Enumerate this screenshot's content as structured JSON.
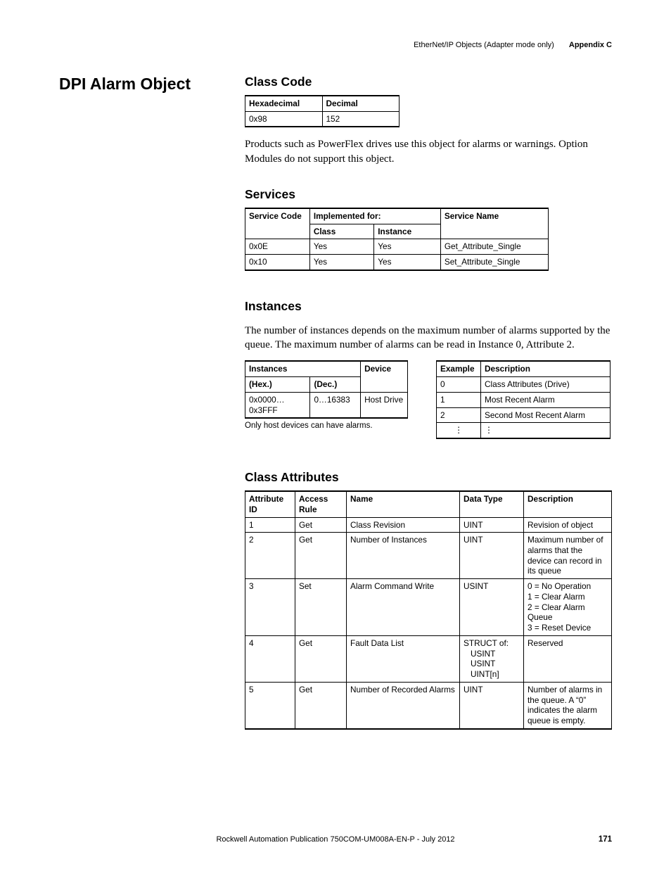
{
  "running_head": {
    "title": "EtherNet/IP Objects (Adapter mode only)",
    "appendix": "Appendix C"
  },
  "side_heading": "DPI Alarm Object",
  "class_code": {
    "heading": "Class Code",
    "headers": {
      "hex": "Hexadecimal",
      "dec": "Decimal"
    },
    "row": {
      "hex": "0x98",
      "dec": "152"
    }
  },
  "intro_paragraph": "Products such as PowerFlex drives use this object for alarms or warnings. Option Modules do not support this object.",
  "services": {
    "heading": "Services",
    "headers": {
      "code": "Service Code",
      "impl": "Implemented for:",
      "class": "Class",
      "instance": "Instance",
      "name": "Service Name"
    },
    "rows": [
      {
        "code": "0x0E",
        "class": "Yes",
        "instance": "Yes",
        "name": "Get_Attribute_Single"
      },
      {
        "code": "0x10",
        "class": "Yes",
        "instance": "Yes",
        "name": "Set_Attribute_Single"
      }
    ]
  },
  "instances": {
    "heading": "Instances",
    "paragraph": "The number of instances depends on the maximum number of alarms supported by the queue. The maximum number of alarms can be read in Instance 0, Attribute 2.",
    "table": {
      "headers": {
        "instances": "Instances",
        "device": "Device",
        "hex": "(Hex.)",
        "dec": "(Dec.)"
      },
      "row": {
        "hex": "0x0000…0x3FFF",
        "dec": "0…16383",
        "device": "Host Drive"
      }
    },
    "footnote": "Only host devices can have alarms.",
    "examples": {
      "headers": {
        "example": "Example",
        "desc": "Description"
      },
      "rows": [
        {
          "ex": "0",
          "desc": "Class Attributes (Drive)"
        },
        {
          "ex": "1",
          "desc": "Most Recent Alarm"
        },
        {
          "ex": "2",
          "desc": "Second Most Recent Alarm"
        },
        {
          "ex": "⋮",
          "desc": "⋮"
        }
      ]
    }
  },
  "class_attributes": {
    "heading": "Class Attributes",
    "headers": {
      "id": "Attribute ID",
      "rule": "Access Rule",
      "name": "Name",
      "type": "Data Type",
      "desc": "Description"
    },
    "rows": [
      {
        "id": "1",
        "rule": "Get",
        "name": "Class Revision",
        "type": "UINT",
        "desc": "Revision of object"
      },
      {
        "id": "2",
        "rule": "Get",
        "name": "Number of Instances",
        "type": "UINT",
        "desc": "Maximum number of alarms that the device can record in its queue"
      },
      {
        "id": "3",
        "rule": "Set",
        "name": "Alarm Command Write",
        "type": "USINT",
        "desc_lines": [
          "0 = No Operation",
          "1 = Clear Alarm",
          "2 = Clear Alarm Queue",
          "3 = Reset Device"
        ]
      },
      {
        "id": "4",
        "rule": "Get",
        "name": "Fault Data List",
        "type_lines": [
          "STRUCT of:",
          "USINT",
          "USINT",
          "UINT[n]"
        ],
        "desc": "Reserved"
      },
      {
        "id": "5",
        "rule": "Get",
        "name": "Number of Recorded Alarms",
        "type": "UINT",
        "desc": "Number of alarms in the queue. A “0” indicates the alarm queue is empty."
      }
    ]
  },
  "footer": {
    "pub": "Rockwell Automation Publication 750COM-UM008A-EN-P - July 2012",
    "page": "171"
  }
}
